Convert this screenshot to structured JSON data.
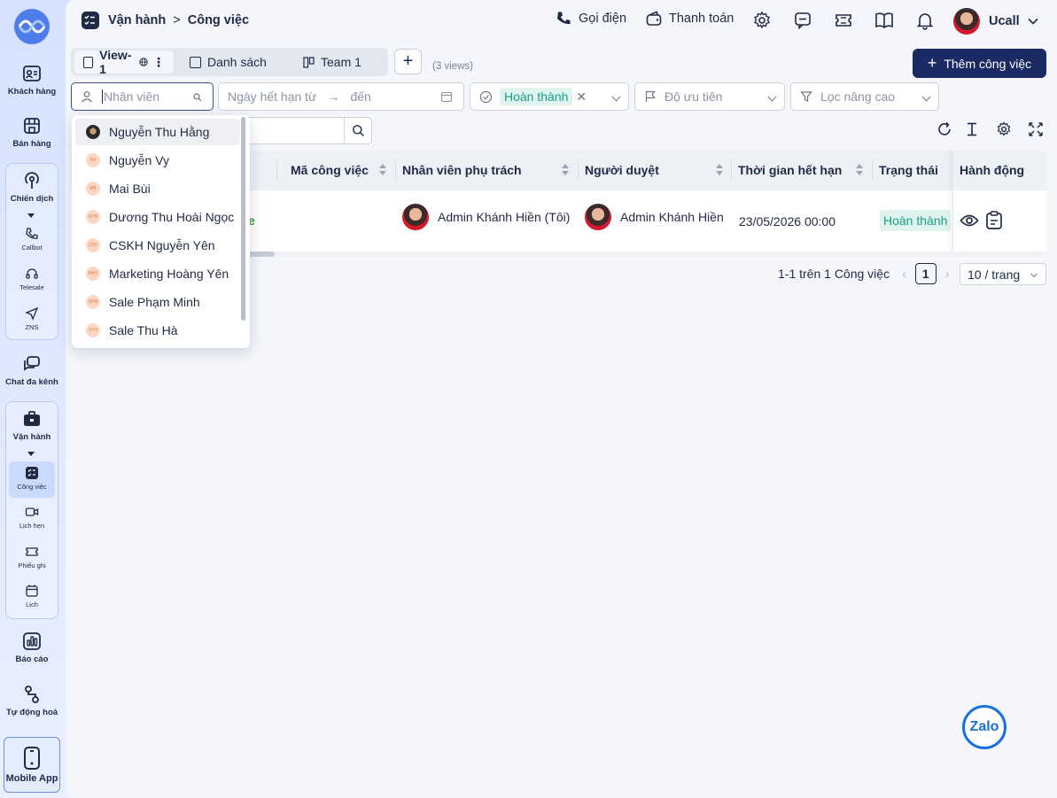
{
  "sidebar": {
    "customers": "Khách hàng",
    "sales": "Bán hàng",
    "campaign": "Chiến dịch",
    "callbot": "Callbot",
    "telesale": "Telesale",
    "zns": "ZNS",
    "omnichat": "Chat đa kênh",
    "operations": "Vận hành",
    "tasks": "Công việc",
    "appointments": "Lịch hẹn",
    "tickets": "Phiếu ghi",
    "calendar": "Lịch",
    "reports": "Báo cáo",
    "automation": "Tự động hoá",
    "mobile_app": "Mobile App"
  },
  "breadcrumb": {
    "section": "Vận hành",
    "separator": ">",
    "page": "Công việc"
  },
  "topbar": {
    "call": "Gọi điện",
    "payment": "Thanh toán",
    "user_name": "Ucall"
  },
  "views": {
    "tabs": [
      {
        "label": "View-1"
      },
      {
        "label": "Danh sách"
      },
      {
        "label": "Team 1"
      }
    ],
    "count": "(3 views)"
  },
  "actions": {
    "add_task": "Thêm công việc"
  },
  "filters": {
    "employee_placeholder": "Nhân viên",
    "due_from": "Ngày hết hạn từ",
    "due_to": "đến",
    "status_tag": "Hoàn thành",
    "priority": "Độ ưu tiên",
    "advanced": "Lọc nâng cao"
  },
  "table": {
    "headers": {
      "code": "Mã công việc",
      "assignee": "Nhân viên phụ trách",
      "approver": "Người duyệt",
      "due": "Thời gian hết hạn",
      "status": "Trạng thái",
      "action": "Hành động"
    },
    "rows": [
      {
        "assignee": "Admin Khánh Hiền (Tôi)",
        "approver": "Admin Khánh Hiền",
        "due": "23/05/2026 00:00",
        "status": "Hoàn thành"
      }
    ]
  },
  "pagination": {
    "summary": "1-1 trên 1 Công việc",
    "current": "1",
    "page_size": "10 / trang"
  },
  "employee_dropdown": {
    "items": [
      {
        "label": "Nguyễn Thu Hằng",
        "initials": ""
      },
      {
        "label": "Nguyễn Vy",
        "initials": "NV"
      },
      {
        "label": "Mai Bùi",
        "initials": "MB"
      },
      {
        "label": "Dương Thu Hoài Ngọc",
        "initials": "DTN"
      },
      {
        "label": "CSKH Nguyễn Yên",
        "initials": "CNY"
      },
      {
        "label": "Marketing Hoàng Yên",
        "initials": "MHY"
      },
      {
        "label": "Sale Phạm Minh",
        "initials": "SPM"
      },
      {
        "label": "Sale Thu Hà",
        "initials": "STH"
      }
    ]
  },
  "zalo": "Zalo",
  "colors": {
    "primary": "#1b2a63",
    "success": "#16a085",
    "accent_blue": "#1a6fe0"
  }
}
